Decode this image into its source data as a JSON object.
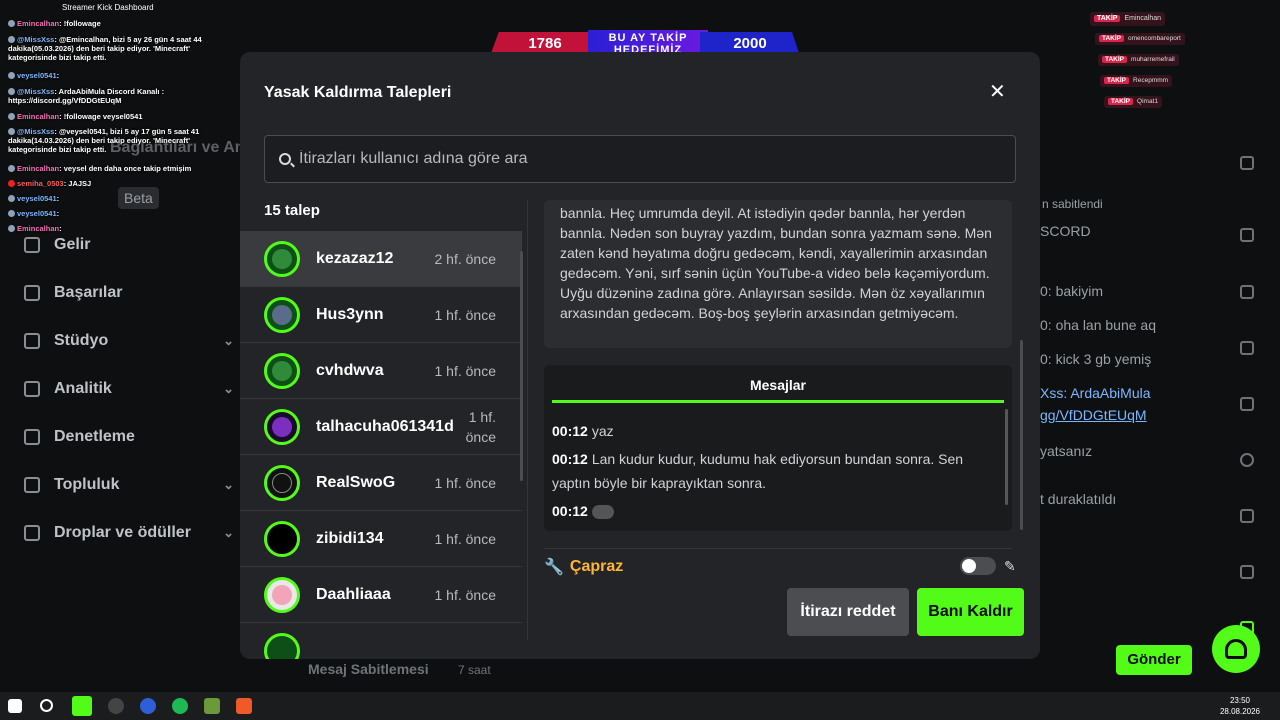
{
  "window": {
    "title": "Streamer Kick Dashboard"
  },
  "goal_banner": {
    "current": "1786",
    "label": "BU AY TAKİP HEDEFİMİZ",
    "target": "2000"
  },
  "chat_overlay": [
    {
      "user": "Emincalhan",
      "text": "!followage"
    },
    {
      "user": "@MissXss",
      "text": "@Emincalhan, bizi 5 ay 26 gün 4 saat 44 dakika(05.03.2026) den beri takip ediyor. 'Minecraft' kategorisinde bizi takip etti."
    },
    {
      "user": "veysel0541",
      "text": ""
    },
    {
      "user": "@MissXss",
      "text": "ArdaAbiMula Discord Kanalı : https://discord.gg/VfDDGtEUqM"
    },
    {
      "user": "Emincalhan",
      "text": "!followage veysel0541"
    },
    {
      "user": "@MissXss",
      "text": "@veysel0541, bizi 5 ay 17 gün 5 saat 41 dakika(14.03.2026) den beri takip ediyor. 'Minecraft' kategorisinde bizi takip etti."
    },
    {
      "user": "Emincalhan",
      "text": "veysel den daha once takip etmişim"
    },
    {
      "user": "semiha_0503",
      "text": "JAJSJ"
    },
    {
      "user": "veysel0541",
      "text": ""
    },
    {
      "user": "veysel0541",
      "text": ""
    },
    {
      "user": "Emincalhan",
      "text": ""
    }
  ],
  "notifications": [
    {
      "badge": "TAKİP",
      "user": "Emincalhan"
    },
    {
      "badge": "TAKİP",
      "user": "omencombareport"
    },
    {
      "badge": "TAKİP",
      "user": "muharremefrail"
    },
    {
      "badge": "TAKİP",
      "user": "Recepmmm"
    },
    {
      "badge": "TAKİP",
      "user": "Qimat1"
    }
  ],
  "sidebar": {
    "beta_label": "Beta",
    "items": [
      {
        "label": "Gelir",
        "chevron": false
      },
      {
        "label": "Başarılar",
        "chevron": false
      },
      {
        "label": "Stüdyo",
        "chevron": true
      },
      {
        "label": "Analitik",
        "chevron": true
      },
      {
        "label": "Denetleme",
        "chevron": false
      },
      {
        "label": "Topluluk",
        "chevron": true
      },
      {
        "label": "Droplar ve ödüller",
        "chevron": true
      }
    ]
  },
  "modal": {
    "title": "Yasak Kaldırma Talepleri",
    "search_placeholder": "İtirazları kullanıcı adına göre ara",
    "count_label": "15 talep",
    "requests": [
      {
        "username": "kezazaz12",
        "time": "2 hf. önce",
        "selected": true,
        "avatar_color": "#2f8a3a"
      },
      {
        "username": "Hus3ynn",
        "time": "1 hf. önce",
        "selected": false,
        "avatar_color": "#5a6b8c"
      },
      {
        "username": "cvhdwva",
        "time": "1 hf. önce",
        "selected": false,
        "avatar_color": "#2f8a3a"
      },
      {
        "username": "talhacuha061341d",
        "time": "1 hf. önce",
        "selected": false,
        "avatar_color": "#7b2fbf"
      },
      {
        "username": "RealSwoG",
        "time": "1 hf. önce",
        "selected": false,
        "avatar_color": "#111111"
      },
      {
        "username": "zibidi134",
        "time": "1 hf. önce",
        "selected": false,
        "avatar_color": "#000000"
      },
      {
        "username": "Daahliaaa",
        "time": "1 hf. önce",
        "selected": false,
        "avatar_color": "#f2f2f2"
      }
    ],
    "reason_text": "bannla. Heç umrumda deyil. At istədiyin qədər bannla, hər yerdən bannla. Nədən son buyray yazdım, bundan sonra yazmam sənə. Mən zaten kənd həyatıma doğru gedəcəm, kəndi, xayallerimin arxasından gedəcəm. Yəni, sırf sənin üçün YouTube-a video belə kəçəmiyordum. Uyğu düzəninə zadına görə. Anlayırsan səsildə. Mən öz xəyallarımın arxasından gedəcəm. Boş-boş şeylərin arxasından getmiyəcəm.",
    "messages_tab": "Mesajlar",
    "messages": [
      {
        "time": "00:12",
        "text": "yaz"
      },
      {
        "time": "00:12",
        "text": "Lan kudur kudur, kudumu hak ediyorsun bundan sonra. Sen yaptın böyle bir kaprayıktan sonra."
      },
      {
        "time": "00:12",
        "text": ""
      }
    ],
    "action_label": "Çapraz",
    "reject_label": "İtirazı reddet",
    "unban_label": "Banı Kaldır"
  },
  "bg_right": {
    "pinned": "n sabitlendi",
    "discord": "SCORD",
    "lines": [
      "0: bakiyim",
      "0: oha lan bune aq",
      "0: kick 3 gb yemiş",
      "Xss: ArdaAbiMula",
      "gg/VfDDGtEUqM",
      "yatsanız",
      "t duraklatıldı"
    ],
    "send_label": "Gönder",
    "pin_label": "Mesaj Sabitlemesi",
    "pin_time": "7 saat"
  },
  "taskbar": {
    "time": "23:50",
    "date": "28.08.2026"
  },
  "colors": {
    "accent": "#53fc18",
    "modal_bg": "#232427",
    "action": "#ffb636"
  }
}
